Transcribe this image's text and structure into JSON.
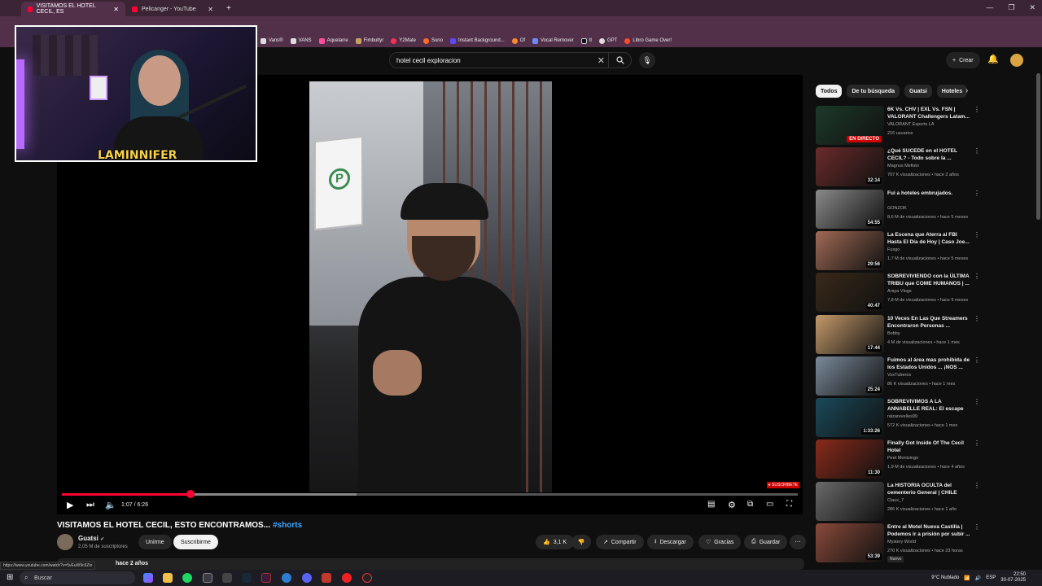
{
  "browser": {
    "tabs": [
      {
        "label": "VISITAMOS EL HOTEL CECIL, ES",
        "active": true
      },
      {
        "label": "Pelicanger - YouTube",
        "active": false
      }
    ],
    "bookmarks": [
      "Vans®",
      "VANS",
      "Aquelarre",
      "Fimbultyr",
      "Y2Mate",
      "Suno",
      "Instant Background...",
      "Of",
      "Vocal Remover",
      "tt",
      "GPT",
      "Libro Game Over!"
    ]
  },
  "youtube": {
    "search_value": "hotel cecil exploracion",
    "create_label": "Crear",
    "player": {
      "time": "1:07 / 6:26",
      "progress_played": 0.175,
      "progress_buffered": 0.4,
      "watermark": "● SUSCRIBETE"
    },
    "video_title": "VISITAMOS EL HOTEL CECIL, ESTO ENCONTRAMOS...",
    "video_tag": "#shorts",
    "channel": {
      "name": "Guatsi",
      "subs": "2,05 M de suscriptores"
    },
    "buttons": {
      "join": "Unirme",
      "subscribe": "Suscribirme",
      "likes": "3,1 K",
      "share": "Compartir",
      "download": "Descargar",
      "thanks": "Gracias",
      "save": "Guardar"
    },
    "description_meta": "hace 2 años",
    "status_url": "https://www.youtube.com/watch?v=5vEuW9c6Zio",
    "chips": [
      "Todos",
      "De tu búsqueda",
      "Guatsi",
      "Hoteles"
    ],
    "recommendations": [
      {
        "title": "6K Vs. CHV | EXL Vs. FSN | VALORANT Challengers Latam...",
        "channel": "VALORANT Esports LA",
        "meta": "216 usuarios",
        "badge": "EN DIRECTO",
        "live": true,
        "color": "#1d3a2a"
      },
      {
        "title": "¿Qué SUCEDE en el HOTEL CECIL? - Todo sobre la ...",
        "channel": "Magnus Mefisto",
        "meta": "707 K visualizaciones • hace 2 años",
        "badge": "32:14",
        "color": "#6b2b2b"
      },
      {
        "title": "Fui a hoteles embrujados.",
        "channel": "GONZOK",
        "meta": "8,6 M de visualizaciones • hace 5 meses",
        "badge": "54:55",
        "color": "#8a8a8a"
      },
      {
        "title": "La Escena que Aterra al FBI Hasta El Día de Hoy | Caso Joe...",
        "channel": "Fusgo",
        "meta": "1,7 M de visualizaciones • hace 5 meses",
        "badge": "29:56",
        "color": "#a06a55"
      },
      {
        "title": "SOBREVIVIENDO con la ÚLTIMA TRIBU que COME HUMANOS | ...",
        "channel": "Araya Vlogs",
        "meta": "7,8 M de visualizaciones • hace 9 meses",
        "badge": "40:47",
        "color": "#3a2a1a"
      },
      {
        "title": "10 Veces En Las Que Streamers Encontraron Personas ...",
        "channel": "Bobby",
        "meta": "4 M de visualizaciones • hace 1 mes",
        "badge": "17:44",
        "color": "#c49a6a"
      },
      {
        "title": "Fuimos al área mas prohibida de los Estados Unidos ... ¡NOS ...",
        "channel": "VoxTuberos",
        "meta": "86 K visualizaciones • hace 1 mes",
        "badge": "25:24",
        "color": "#7a8a9a"
      },
      {
        "title": "SOBREVIVIMOS A LA ANNABELLE REAL: El escape",
        "channel": "raizarevelles99",
        "meta": "572 K visualizaciones • hace 1 mes",
        "badge": "1:33:26",
        "color": "#1a4a5a"
      },
      {
        "title": "Finally Got Inside Of The Cecil Hotel",
        "channel": "Peet Montzingo",
        "meta": "1,9 M de visualizaciones • hace 4 años",
        "badge": "11:30",
        "color": "#8a2a1a"
      },
      {
        "title": "La HISTORIA OCULTA del cementerio General | CHILE",
        "channel": "Claux_7",
        "meta": "286 K visualizaciones • hace 1 año",
        "badge": "",
        "color": "#6a6a6a"
      },
      {
        "title": "Entre al Motel Nueva Castilla | Podemos ir a prisión por subir ...",
        "channel": "Mystery World",
        "meta": "270 K visualizaciones • hace 23 horas",
        "badge": "53:39",
        "new": "Nuevo",
        "color": "#8a4a3a"
      }
    ]
  },
  "webcam": {
    "logo": "LAMINNIFER"
  },
  "taskbar": {
    "search_placeholder": "Buscar",
    "weather": "9°C  Nublado",
    "lang": "ESP",
    "time": "22:50",
    "date": "30-07-2025"
  }
}
